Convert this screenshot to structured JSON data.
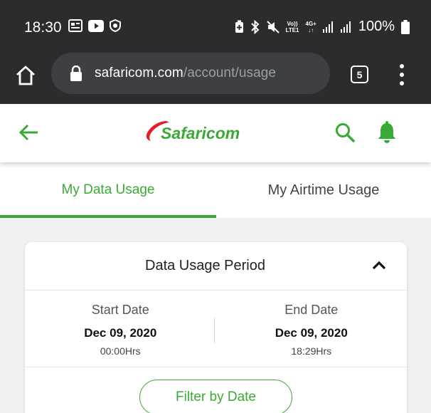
{
  "status_bar": {
    "time": "18:30",
    "network_top": "Vo))",
    "network_bottom": "LTE1",
    "network_type": "4G+",
    "battery": "100%"
  },
  "browser": {
    "url_domain": "safaricom.com",
    "url_path": "/account/usage",
    "tab_count": "5"
  },
  "app": {
    "logo_text": "Safaricom"
  },
  "tabs": [
    {
      "label": "My Data Usage",
      "active": true
    },
    {
      "label": "My Airtime Usage",
      "active": false
    }
  ],
  "card": {
    "title": "Data Usage Period",
    "start": {
      "label": "Start Date",
      "date": "Dec 09, 2020",
      "time": "00:00Hrs"
    },
    "end": {
      "label": "End Date",
      "date": "Dec 09, 2020",
      "time": "18:29Hrs"
    },
    "filter_label": "Filter by Date"
  },
  "colors": {
    "brand_green": "#3aa935",
    "brand_red": "#e21f26",
    "dark_bar": "#2b2c2e"
  }
}
